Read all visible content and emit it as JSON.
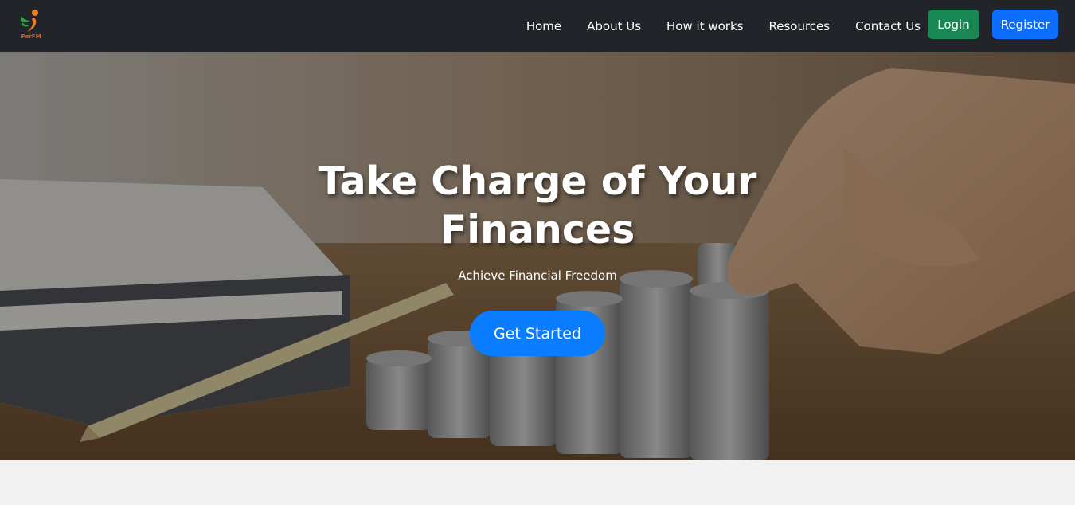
{
  "brand": {
    "logo_text": "PerFM",
    "colors": {
      "primary": "#0d6efd",
      "success": "#198754",
      "nav_bg": "#212529",
      "cta": "#0a7cff"
    }
  },
  "nav": {
    "links": [
      "Home",
      "About Us",
      "How it works",
      "Resources",
      "Contact Us"
    ],
    "login_label": "Login",
    "register_label": "Register"
  },
  "hero": {
    "title": "Take Charge of Your Finances",
    "subtitle": "Achieve Financial Freedom",
    "cta_label": "Get Started",
    "background": "coins-stacking-photo"
  }
}
